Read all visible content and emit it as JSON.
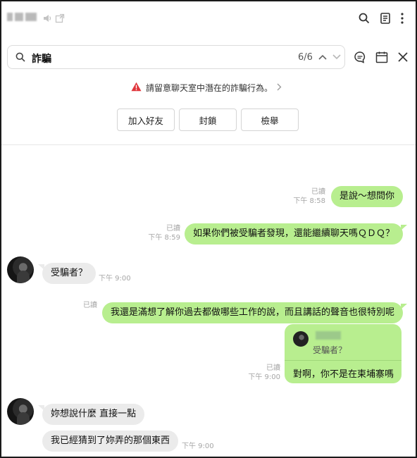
{
  "header": {
    "icons": [
      "speaker-icon",
      "popout-icon",
      "search-icon",
      "notes-icon",
      "more-icon"
    ]
  },
  "search": {
    "query": "詐騙",
    "count": "6/6"
  },
  "warning": {
    "text": "請留意聊天室中潛在的詐騙行為。",
    "buttons": [
      "加入好友",
      "封鎖",
      "檢舉"
    ]
  },
  "messages": [
    {
      "side": "mine",
      "read": "已讀",
      "time": "下午 8:58",
      "text": "是說～想問你"
    },
    {
      "side": "mine",
      "read": "已讀",
      "time": "下午 8:59",
      "text": "如果你們被受騙者發現，還能繼續聊天嗎ＱＤＱ？"
    },
    {
      "side": "theirs",
      "time": "下午 9:00",
      "text": "受騙者？"
    },
    {
      "side": "mine",
      "read": "已讀",
      "text": "我還是滿想了解你過去都做哪些工作的說，而且講話的聲音也很特別呢"
    },
    {
      "side": "mine",
      "read": "已讀",
      "time": "下午 9:00",
      "quote": "受騙者？",
      "text": "對啊，你不是在柬埔寨嗎"
    },
    {
      "side": "theirs",
      "text": "妳想說什麼 直接一點"
    },
    {
      "side": "theirs",
      "time": "下午 9:00",
      "text": "我已經猜到了妳弄的那個東西"
    }
  ],
  "colors": {
    "my_bubble": "#b8ee8f",
    "their_bubble": "#ebebeb",
    "warning_red": "#e0353b"
  }
}
